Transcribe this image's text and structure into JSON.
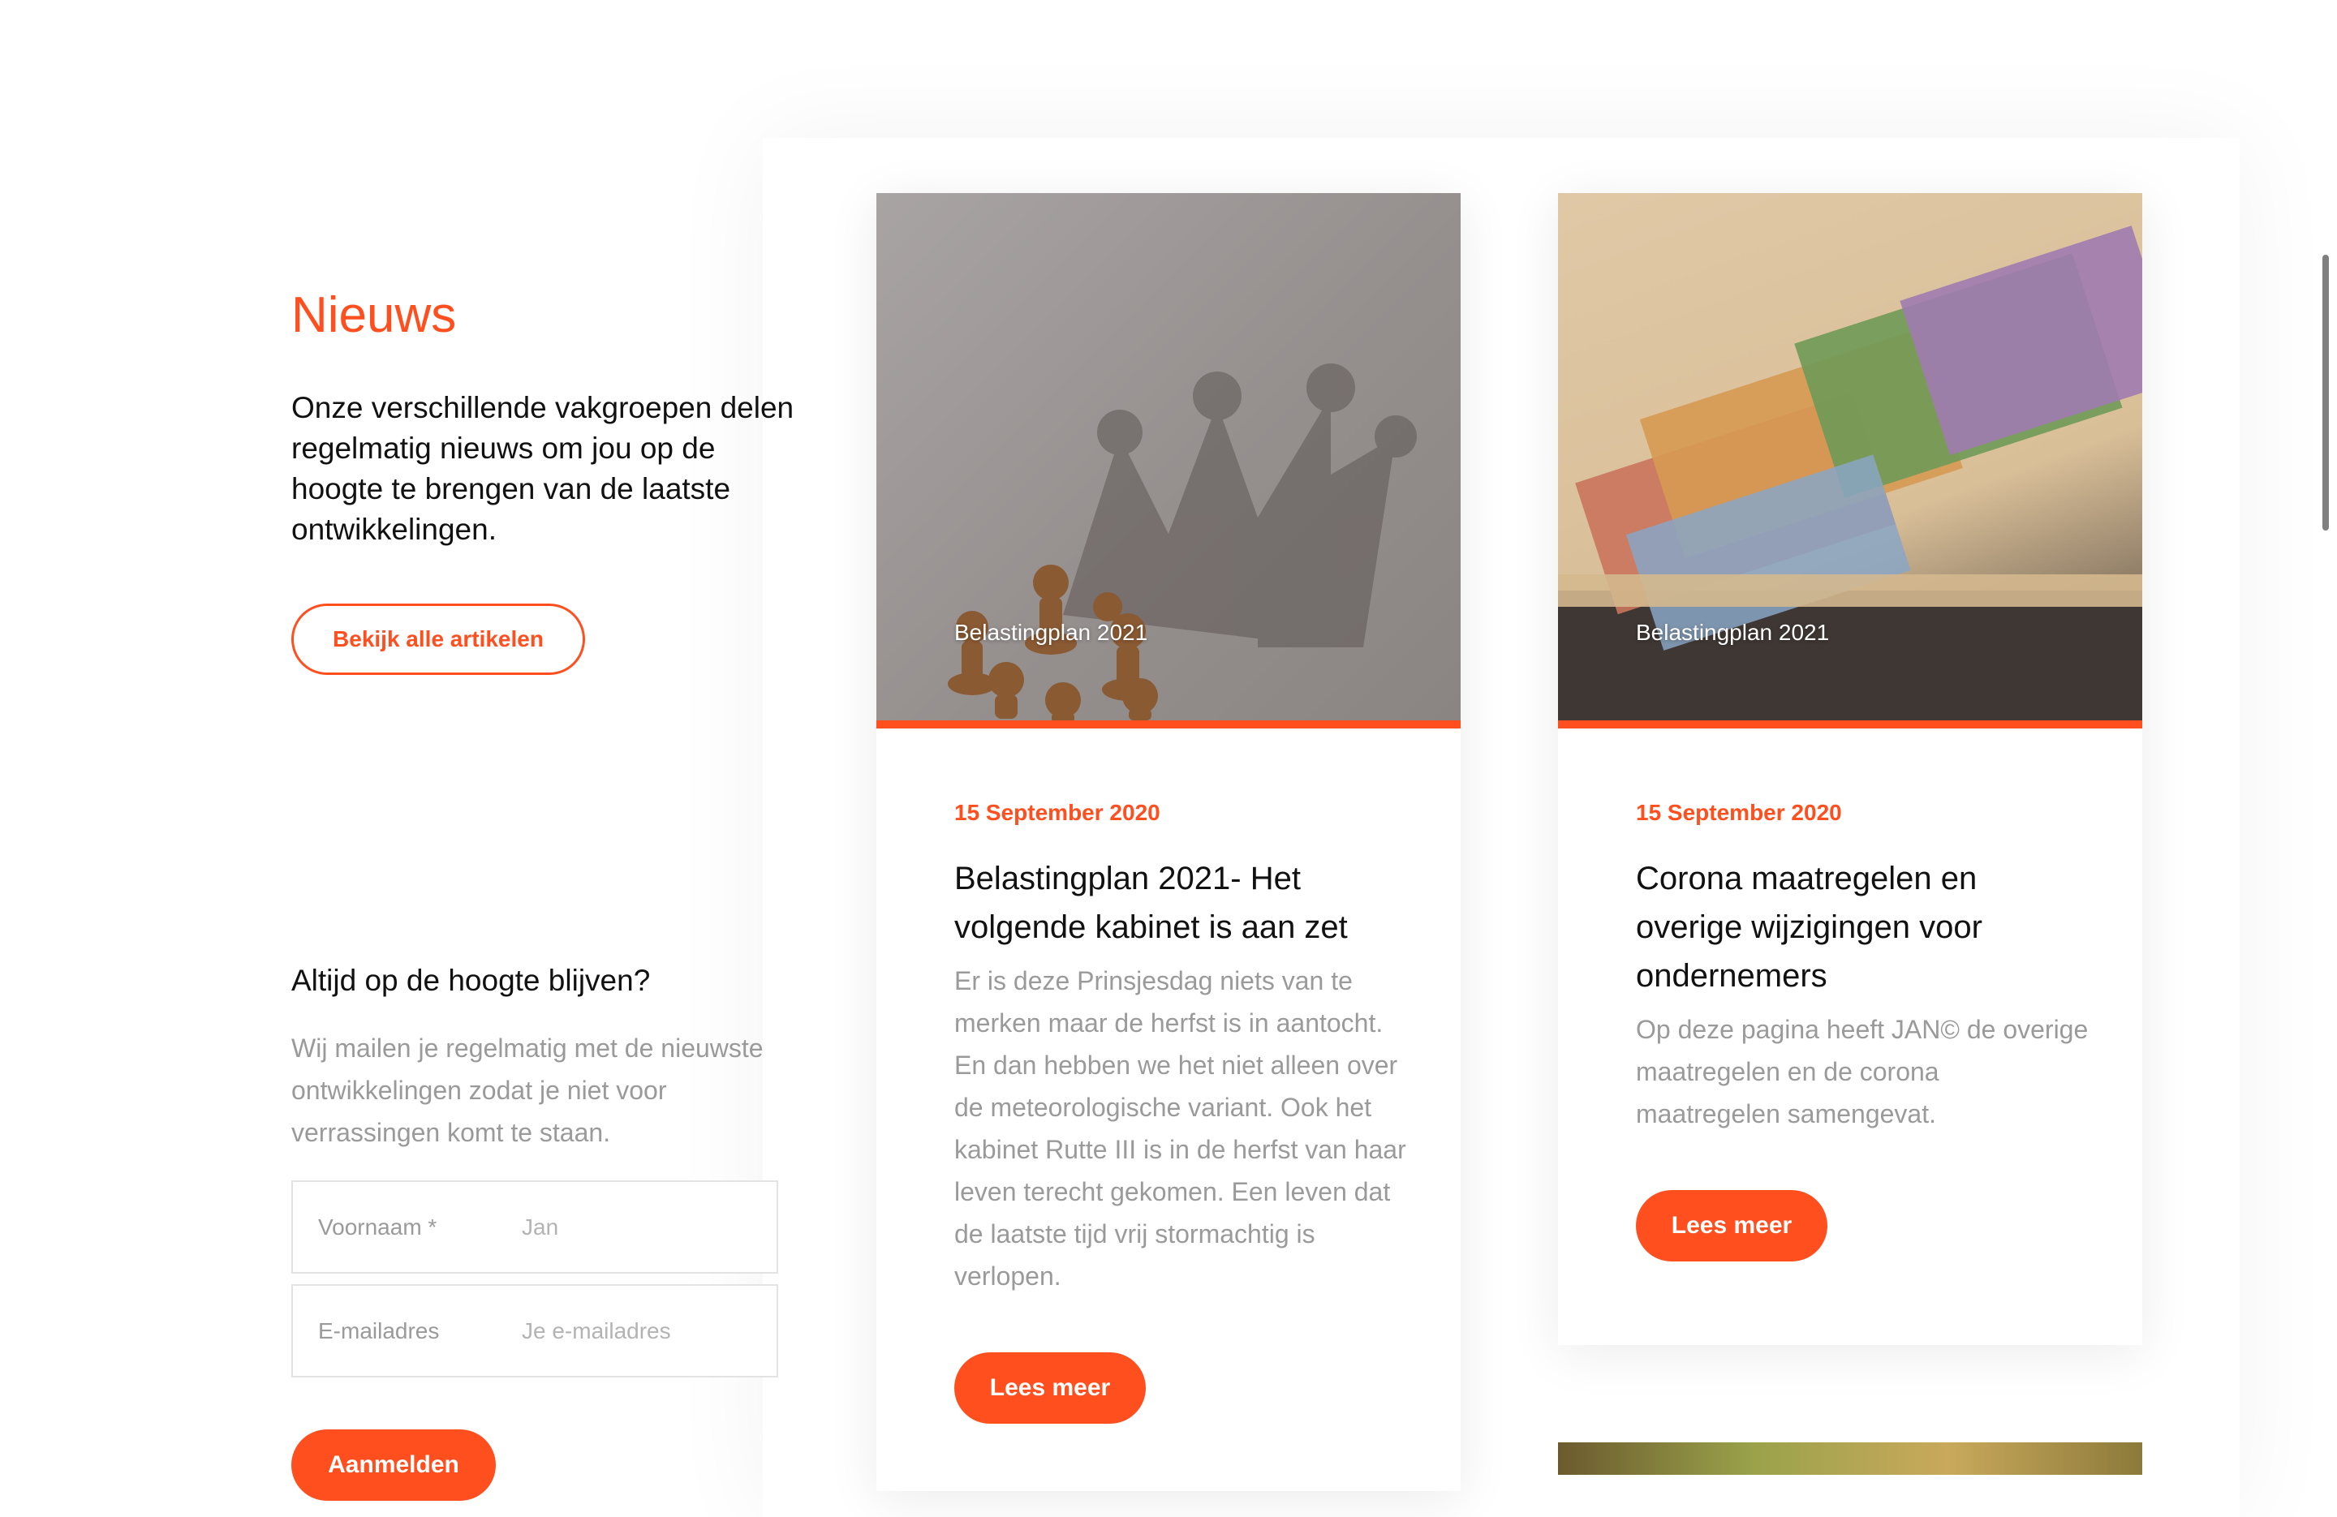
{
  "news": {
    "title": "Nieuws",
    "intro": "Onze verschillende vakgroepen delen regelmatig nieuws om jou op de hoogte te brengen van de laatste ontwikkelingen.",
    "all_articles_label": "Bekijk alle artikelen"
  },
  "newsletter": {
    "title": "Altijd op de hoogte blijven?",
    "text": "Wij mailen je regelmatig met de nieuwste ontwikkelingen zodat je niet voor verrassingen komt te staan.",
    "firstname_label": "Voornaam *",
    "firstname_placeholder": "Jan",
    "email_label": "E-mailadres",
    "email_placeholder": "Je e-mailadres",
    "submit_label": "Aanmelden"
  },
  "articles": [
    {
      "image_alt": "chess-pawns-crown-shadow",
      "category": "Belastingplan 2021",
      "date": "15 September 2020",
      "title": "Belastingplan 2021- Het volgende kabinet is aan zet",
      "excerpt": "Er is deze Prinsjesdag niets van te merken maar de herfst is in aantocht. En dan hebben we het niet alleen over de meteorologische variant. Ook het kabinet Rutte III is in de herfst van haar leven terecht gekomen. Een leven dat de laatste tijd vrij stormachtig is verlopen.",
      "button_label": "Lees meer"
    },
    {
      "image_alt": "euro-banknotes-envelope",
      "category": "Belastingplan 2021",
      "date": "15 September 2020",
      "title": "Corona maatregelen en overige wijzigingen voor ondernemers",
      "excerpt": "Op deze pagina heeft JAN© de overige maatregelen en de corona maatregelen samengevat.",
      "button_label": "Lees meer"
    }
  ],
  "colors": {
    "accent": "#ff4f1f",
    "text": "#111111",
    "muted": "#9a9a9a"
  }
}
